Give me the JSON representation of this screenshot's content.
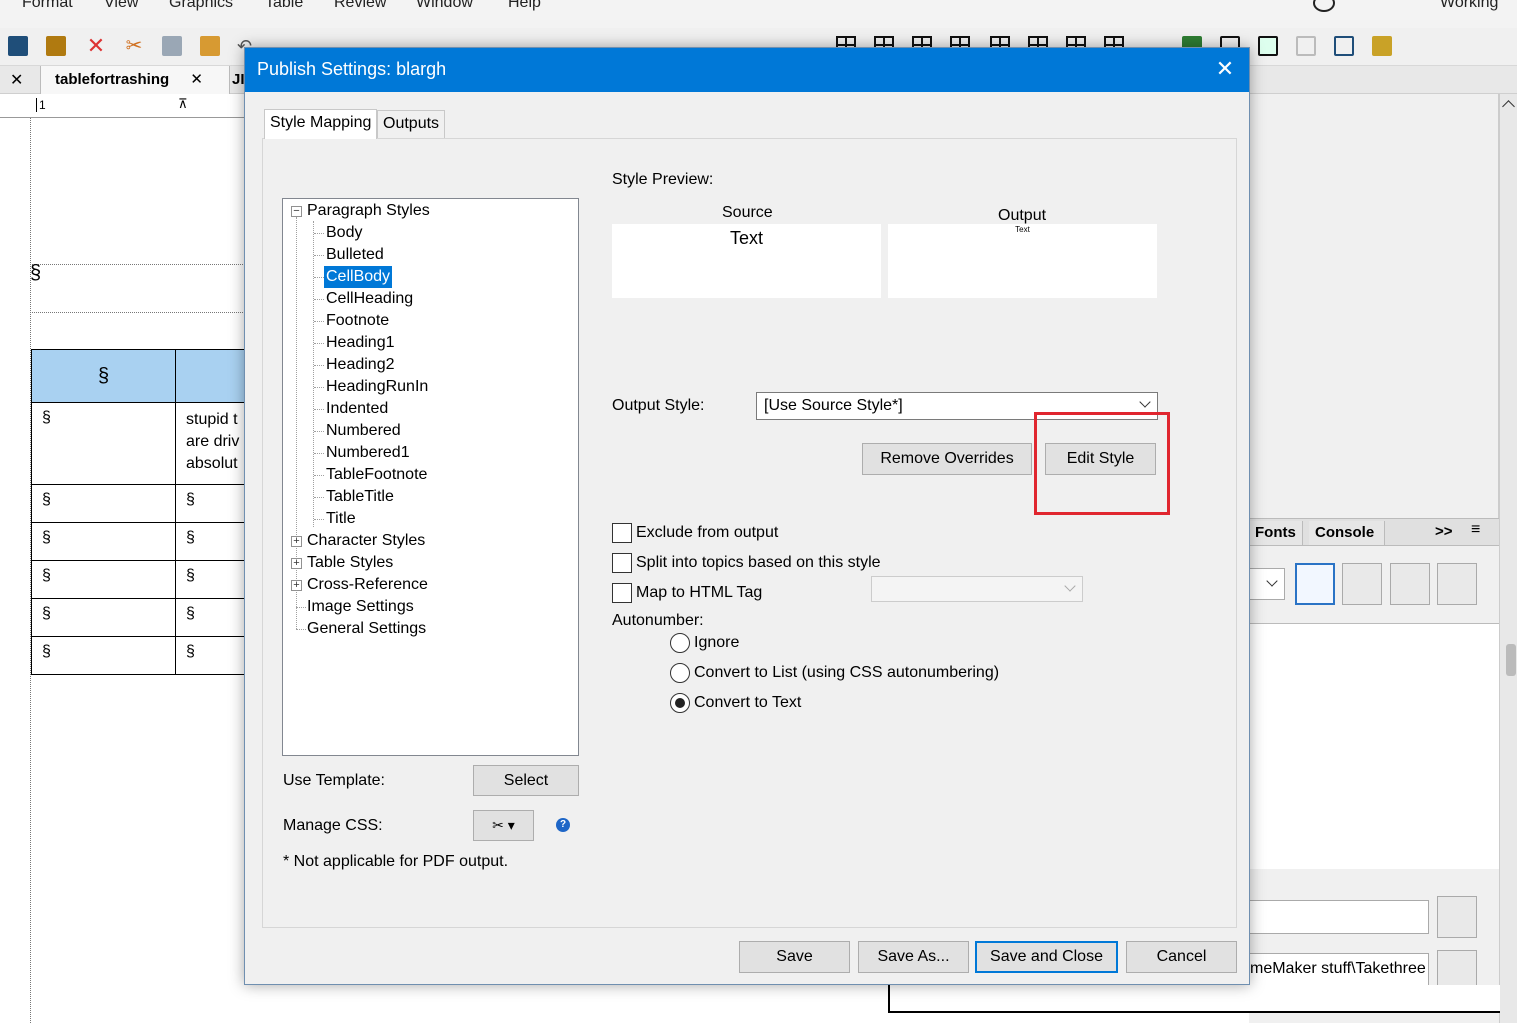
{
  "menu": [
    "Format",
    "View",
    "Graphics",
    "Table",
    "Review",
    "Window",
    "Help"
  ],
  "workspace_label": "Working",
  "doc_tabs": {
    "active": "tablefortrashing",
    "other": "JI"
  },
  "doc_table": {
    "head_marker": "§",
    "row1_col1": "§",
    "row1_col2_lines": [
      "stupid t",
      "are driv",
      "absolut"
    ],
    "cell_marker": "§"
  },
  "right_panel": {
    "tabs": [
      "Fonts",
      "Console"
    ],
    "overflow": ">>",
    "path_text": "meMaker stuff\\Takethree"
  },
  "dialog": {
    "title": "Publish Settings: blargh",
    "tabs": [
      "Style Mapping",
      "Outputs"
    ],
    "tree": {
      "paragraph_group": "Paragraph Styles",
      "paragraph_items": [
        "Body",
        "Bulleted",
        "CellBody",
        "CellHeading",
        "Footnote",
        "Heading1",
        "Heading2",
        "HeadingRunIn",
        "Indented",
        "Numbered",
        "Numbered1",
        "TableFootnote",
        "TableTitle",
        "Title"
      ],
      "selected": "CellBody",
      "other_groups": [
        "Character Styles",
        "Table Styles",
        "Cross-Reference"
      ],
      "leaf_groups": [
        "Image Settings",
        "General Settings"
      ]
    },
    "use_template_label": "Use Template:",
    "select_button": "Select",
    "manage_css_label": "Manage CSS:",
    "footnote": "* Not applicable for PDF output.",
    "style_preview_label": "Style Preview:",
    "source_label": "Source",
    "source_text": "Text",
    "output_label": "Output",
    "output_text": "Text",
    "output_style_label": "Output Style:",
    "output_style_value": "[Use Source Style*]",
    "remove_overrides": "Remove Overrides",
    "edit_style": "Edit Style",
    "exclude": "Exclude from output",
    "split": "Split into topics based on this style",
    "map_html": "Map to HTML Tag",
    "map_html_value": "",
    "autonumber_label": "Autonumber:",
    "autonumber_options": [
      "Ignore",
      "Convert to List (using CSS autonumbering)",
      "Convert to Text"
    ],
    "autonumber_selected": "Convert to Text",
    "buttons": {
      "save": "Save",
      "save_as": "Save As...",
      "save_close": "Save and Close",
      "cancel": "Cancel"
    }
  },
  "colors": {
    "title_bar": "#0078d7",
    "highlight": "#e0262f",
    "table_header": "#a9d1f1",
    "selection": "#0078d7"
  }
}
